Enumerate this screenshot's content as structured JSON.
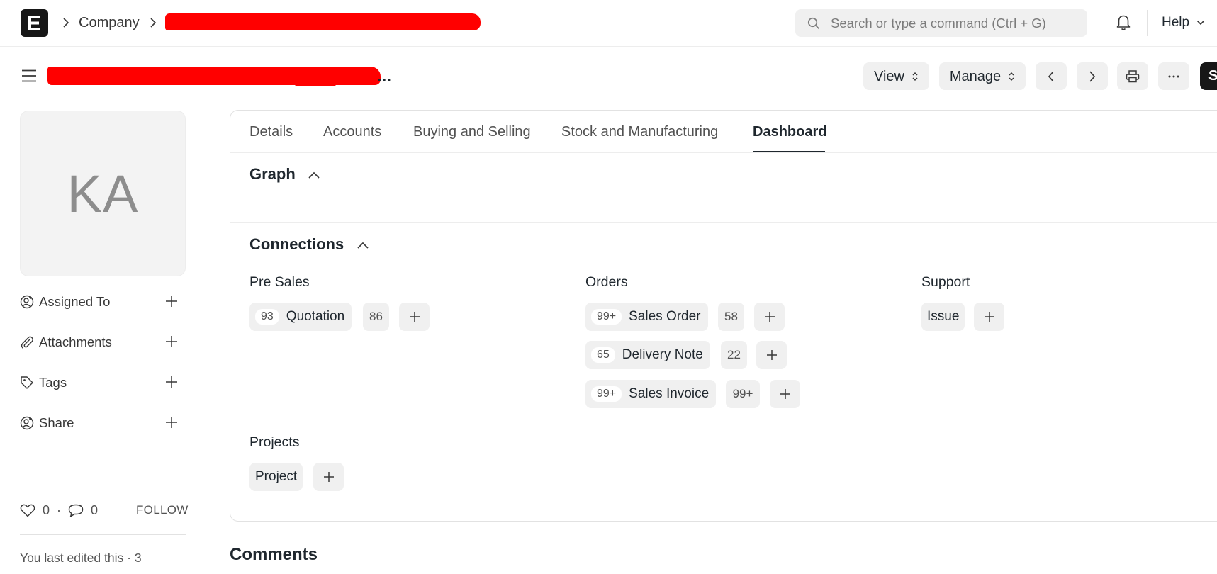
{
  "navbar": {
    "breadcrumb_company": "Company",
    "search_placeholder": "Search or type a command (Ctrl + G)",
    "help_label": "Help"
  },
  "page_head": {
    "title": "...",
    "view_label": "View",
    "manage_label": "Manage",
    "save_label": "S"
  },
  "sidebar": {
    "avatar_initials": "KA",
    "items": [
      {
        "label": "Assigned To",
        "icon": "user-plus-icon"
      },
      {
        "label": "Attachments",
        "icon": "paperclip-icon"
      },
      {
        "label": "Tags",
        "icon": "tag-icon"
      },
      {
        "label": "Share",
        "icon": "share-user-icon"
      }
    ],
    "likes": "0",
    "comments": "0",
    "dot": "·",
    "follow_label": "FOLLOW",
    "last_edited": "You last edited this · 3"
  },
  "tabs": [
    "Details",
    "Accounts",
    "Buying and Selling",
    "Stock and Manufacturing",
    "Dashboard"
  ],
  "active_tab": "Dashboard",
  "sections": {
    "graph": "Graph",
    "connections": "Connections"
  },
  "connections": {
    "pre_sales": {
      "title": "Pre Sales",
      "items": [
        {
          "count": "93",
          "label": "Quotation",
          "open": "86"
        }
      ]
    },
    "orders": {
      "title": "Orders",
      "items": [
        {
          "count": "99+",
          "label": "Sales Order",
          "open": "58"
        },
        {
          "count": "65",
          "label": "Delivery Note",
          "open": "22"
        },
        {
          "count": "99+",
          "label": "Sales Invoice",
          "open": "99+"
        }
      ]
    },
    "support": {
      "title": "Support",
      "items": [
        {
          "label": "Issue"
        }
      ]
    },
    "projects": {
      "title": "Projects",
      "items": [
        {
          "label": "Project"
        }
      ]
    }
  },
  "comments_title": "Comments",
  "colors": {
    "redaction": "#ff0000",
    "text_primary": "#1f272e",
    "button_bg": "#f0f0f0",
    "logo_bg": "#171717"
  }
}
